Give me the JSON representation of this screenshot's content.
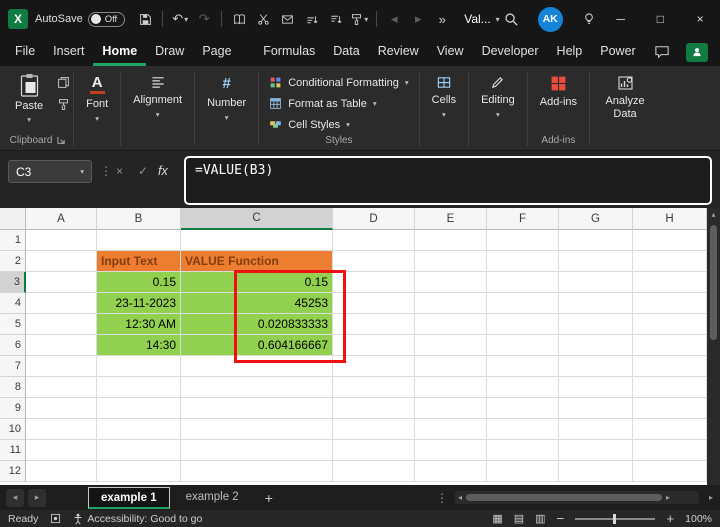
{
  "title_bar": {
    "autosave_label": "AutoSave",
    "autosave_state": "Off",
    "workbook_name": "Val...",
    "avatar_initials": "AK"
  },
  "menu": {
    "items": [
      "File",
      "Insert",
      "Home",
      "Draw",
      "Page Layout",
      "Formulas",
      "Data",
      "Review",
      "View",
      "Developer",
      "Help",
      "Power Pivot"
    ],
    "active": "Home"
  },
  "ribbon": {
    "paste_label": "Paste",
    "clipboard_group_label": "Clipboard",
    "font_group_label": "Font",
    "alignment_group_label": "Alignment",
    "number_group_label": "Number",
    "conditional_formatting_label": "Conditional Formatting",
    "format_as_table_label": "Format as Table",
    "cell_styles_label": "Cell Styles",
    "styles_group_label": "Styles",
    "cells_group_label": "Cells",
    "editing_group_label": "Editing",
    "addins_button_label": "Add-ins",
    "addins_group_label": "Add-ins",
    "analyze_data_label": "Analyze Data"
  },
  "formula_bar": {
    "name_box": "C3",
    "fx_label": "fx",
    "formula": "=VALUE(B3)"
  },
  "grid": {
    "columns": [
      "A",
      "B",
      "C",
      "D",
      "E",
      "F",
      "G",
      "H"
    ],
    "rows": [
      "1",
      "2",
      "3",
      "4",
      "5",
      "6",
      "7",
      "8",
      "9",
      "10",
      "11",
      "12"
    ],
    "selected_column": "C",
    "selected_row": "3",
    "cells": [
      {
        "ref": "B2",
        "text": "Input Text",
        "style": "header",
        "align": "left"
      },
      {
        "ref": "C2",
        "text": "VALUE Function",
        "style": "header",
        "align": "left"
      },
      {
        "ref": "B3",
        "text": "0.15",
        "style": "data",
        "align": "right"
      },
      {
        "ref": "B4",
        "text": "23-11-2023",
        "style": "data",
        "align": "right"
      },
      {
        "ref": "B5",
        "text": "12:30 AM",
        "style": "data",
        "align": "right"
      },
      {
        "ref": "B6",
        "text": "14:30",
        "style": "data",
        "align": "right"
      },
      {
        "ref": "C3",
        "text": "0.15",
        "style": "data",
        "align": "right"
      },
      {
        "ref": "C4",
        "text": "45253",
        "style": "data",
        "align": "right"
      },
      {
        "ref": "C5",
        "text": "0.020833333",
        "style": "data",
        "align": "right"
      },
      {
        "ref": "C6",
        "text": "0.604166667",
        "style": "data",
        "align": "right"
      }
    ]
  },
  "sheet_tabs": {
    "tabs": [
      {
        "label": "example 1",
        "active": true
      },
      {
        "label": "example 2",
        "active": false
      }
    ]
  },
  "status_bar": {
    "ready_label": "Ready",
    "accessibility_label": "Accessibility: Good to go",
    "zoom_level": "100%"
  },
  "icons": {
    "logo_letter": "X",
    "chevron_down": "▾",
    "undo": "↶",
    "redo": "↷",
    "more": "»",
    "vertical_ellipsis": "⋮",
    "cancel": "×",
    "check": "✓",
    "minimize": "─",
    "maximize": "□",
    "close": "×",
    "left": "◂",
    "right": "▸",
    "up": "▴",
    "add_sheet": "+",
    "minus": "−",
    "plus": "+",
    "view_normal": "▦",
    "view_page_layout": "▤",
    "view_page_break": "▥",
    "font_letter": "A",
    "number_sign": "#"
  },
  "colors": {
    "accent_green": "#21A366",
    "excel_green": "#107C41",
    "header_fill_orange": "#ED7D31",
    "header_text_brown": "#843C0C",
    "data_fill_green": "#92D050",
    "annotation_red": "#EE1111",
    "avatar_blue": "#1583D8",
    "addins_red": "#E74C3C"
  }
}
